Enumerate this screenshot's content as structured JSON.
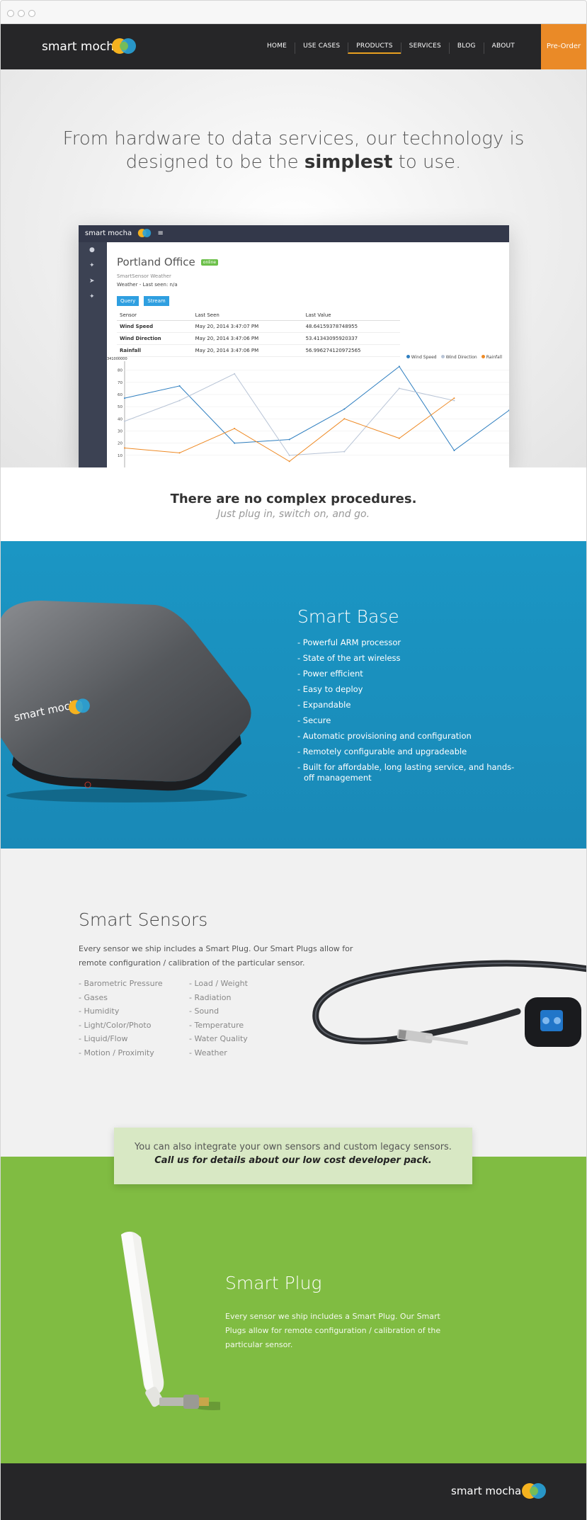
{
  "nav": {
    "logo": "smart mocha",
    "links": [
      "HOME",
      "USE CASES",
      "PRODUCTS",
      "SERVICES",
      "BLOG",
      "ABOUT"
    ],
    "active": "PRODUCTS",
    "preorder": "Pre-Order"
  },
  "hero": {
    "line1": "From hardware to data services, our technology is",
    "line2_pre": "designed to be the ",
    "line2_bold": "simplest",
    "line2_post": " to use."
  },
  "dashboard": {
    "logo": "smart mocha",
    "title": "Portland Office",
    "badge": "online",
    "subtitle": "SmartSensor Weather",
    "subtitle2": "Weather - Last seen: n/a",
    "buttons": [
      "Query",
      "Stream"
    ],
    "columns": [
      "Sensor",
      "Last Seen",
      "Last Value"
    ],
    "rows": [
      [
        "Wind Speed",
        "May 20, 2014 3:47:07 PM",
        "48.64159378748955"
      ],
      [
        "Wind Direction",
        "May 20, 2014 3:47:06 PM",
        "53.41343095920337"
      ],
      [
        "Rainfall",
        "May 20, 2014 3:47:06 PM",
        "56.996274120972565"
      ]
    ],
    "legend": [
      "Wind Speed",
      "Wind Direction",
      "Rainfall"
    ],
    "ymax_label": "341000000",
    "yticks": [
      "80",
      "70",
      "60",
      "50",
      "40",
      "30",
      "20",
      "10"
    ]
  },
  "chart_data": {
    "type": "line",
    "ylim": [
      0,
      85
    ],
    "series": [
      {
        "name": "Wind Speed",
        "color": "#2f7fc0",
        "values": [
          57,
          67,
          20,
          23,
          48,
          83,
          14,
          47
        ]
      },
      {
        "name": "Wind Direction",
        "color": "#b8c4d6",
        "values": [
          38,
          55,
          77,
          10,
          13,
          65,
          55,
          null
        ]
      },
      {
        "name": "Rainfall",
        "color": "#ee8a25",
        "values": [
          16,
          12,
          32,
          5,
          40,
          24,
          57,
          null
        ]
      }
    ]
  },
  "procedures": {
    "heading": "There are no complex procedures.",
    "sub": "Just plug in, switch on, and go."
  },
  "base": {
    "title": "Smart Base",
    "device_label": "smart mocha",
    "features": [
      "- Powerful ARM processor",
      "- State of the art wireless",
      "- Power efficient",
      "- Easy to deploy",
      "- Expandable",
      "- Secure",
      "- Automatic provisioning and configuration",
      "- Remotely configurable and upgradeable",
      "- Built for affordable, long lasting service, and hands-off management"
    ]
  },
  "sensors": {
    "title": "Smart Sensors",
    "desc": "Every sensor we ship includes a Smart Plug. Our Smart Plugs allow for remote configuration / calibration of the particular sensor.",
    "col1": [
      "- Barometric Pressure",
      "- Gases",
      "- Humidity",
      "- Light/Color/Photo",
      "- Liquid/Flow",
      "- Motion / Proximity"
    ],
    "col2": [
      "- Load / Weight",
      "- Radiation",
      "- Sound",
      "- Temperature",
      "- Water Quality",
      "- Weather"
    ]
  },
  "callout": {
    "line1": "You can also integrate your own sensors and custom legacy sensors.",
    "line2": "Call us for details about our low cost developer pack."
  },
  "plug": {
    "title": "Smart Plug",
    "desc": "Every sensor we ship includes a Smart Plug. Our Smart Plugs allow for remote configuration / calibration of the particular sensor."
  },
  "footer": {
    "logo": "smart mocha"
  },
  "colors": {
    "nav": "#262628",
    "accent": "#ea8a27",
    "blue": "#1b96c4",
    "green": "#80bc42"
  }
}
